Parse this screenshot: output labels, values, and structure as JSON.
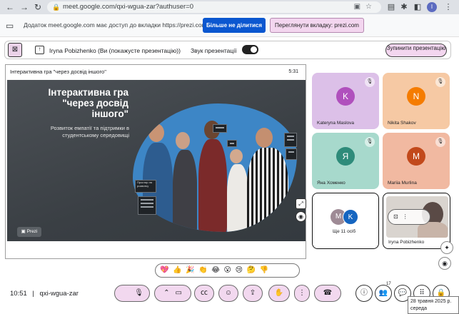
{
  "browser": {
    "url": "meet.google.com/qxi-wgua-zar?authuser=0",
    "profile_initial": "I"
  },
  "share_banner": {
    "message": "Додаток meet.google.com має доступ до вкладки https://prezi.com",
    "stop_sharing": "Більше не ділитися",
    "view_tab": "Переглянути вкладку: prezi.com"
  },
  "presenting_bar": {
    "text": "Iryna Pobizhenko (Ви (покажусте презентацію))",
    "sound_label": "Звук презентації",
    "stop_presenting": "Зупинити презентацію"
  },
  "presentation": {
    "header_title": "Інтерактивна гра \"через досвід іншого\"",
    "header_time": "5:31",
    "slide_title": "Інтерактивна гра \"через досвід іншого\"",
    "slide_subtitle": "Розвиток емпатії та підтримки в студентському середовищі",
    "brand": "Prezi",
    "card_text": "Простир ля розвитку"
  },
  "participants": [
    {
      "name": "Kateryna Maslova",
      "initial": "K",
      "tile_color": "#dcc0e8",
      "avatar_color": "#b050bd"
    },
    {
      "name": "Nikita Shakov",
      "initial": "N",
      "tile_color": "#f6c9a4",
      "avatar_color": "#f57c00"
    },
    {
      "name": "Яна Хоменко",
      "initial": "Я",
      "tile_color": "#a7d9cc",
      "avatar_color": "#2e8b7a"
    },
    {
      "name": "Mariia Murlina",
      "initial": "M",
      "tile_color": "#f1b9a1",
      "avatar_color": "#c2491b"
    }
  ],
  "more_tile": {
    "label": "Ще 11 осіб",
    "initial_1": "M",
    "initial_2": "K"
  },
  "self_tile": {
    "name": "Iryna Pobizhenko"
  },
  "reactions": [
    "💖",
    "👍",
    "🎉",
    "👏",
    "😂",
    "😮",
    "😢",
    "🤔",
    "👎"
  ],
  "toolbar": {
    "time": "10:51",
    "separator": "|",
    "meeting_code": "qxi-wgua-zar",
    "people_count": "17"
  },
  "tooltip": {
    "date": "28 травня 2025 р.",
    "weekday": "середа"
  },
  "colors": {
    "accent": "#f2d8ef",
    "primary_blue": "#0b57d0"
  }
}
